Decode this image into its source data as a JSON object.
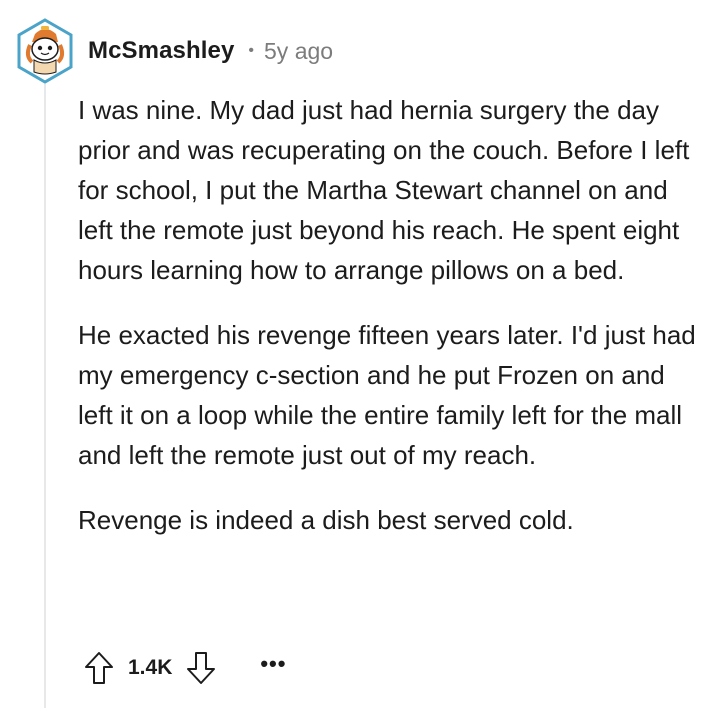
{
  "comment": {
    "author": "McSmashley",
    "separator": "•",
    "age": "5y ago",
    "avatar_icon": "snoo-avatar-icon",
    "paragraphs": [
      "I was nine. My dad just had hernia surgery the day prior and was recuperating on the couch. Before I left for school, I put the Martha Stewart channel on and left the remote just beyond his reach. He spent eight hours learning how to arrange pillows on a bed.",
      "He exacted his revenge fifteen years later. I'd just had my emergency c-section and he put Frozen on and left it on a loop while the entire family left for the mall and left the remote just out of my reach.",
      "Revenge is indeed a dish best served cold."
    ],
    "score": "1.4K",
    "more_label": "•••"
  },
  "icons": {
    "upvote": "upvote-arrow-icon",
    "downvote": "downvote-arrow-icon",
    "more": "more-options-icon"
  },
  "colors": {
    "text": "#1c1c1c",
    "meta": "#7c7c7c",
    "thread_line": "#e6e8ea",
    "avatar_ring": "#4aa3c8"
  }
}
